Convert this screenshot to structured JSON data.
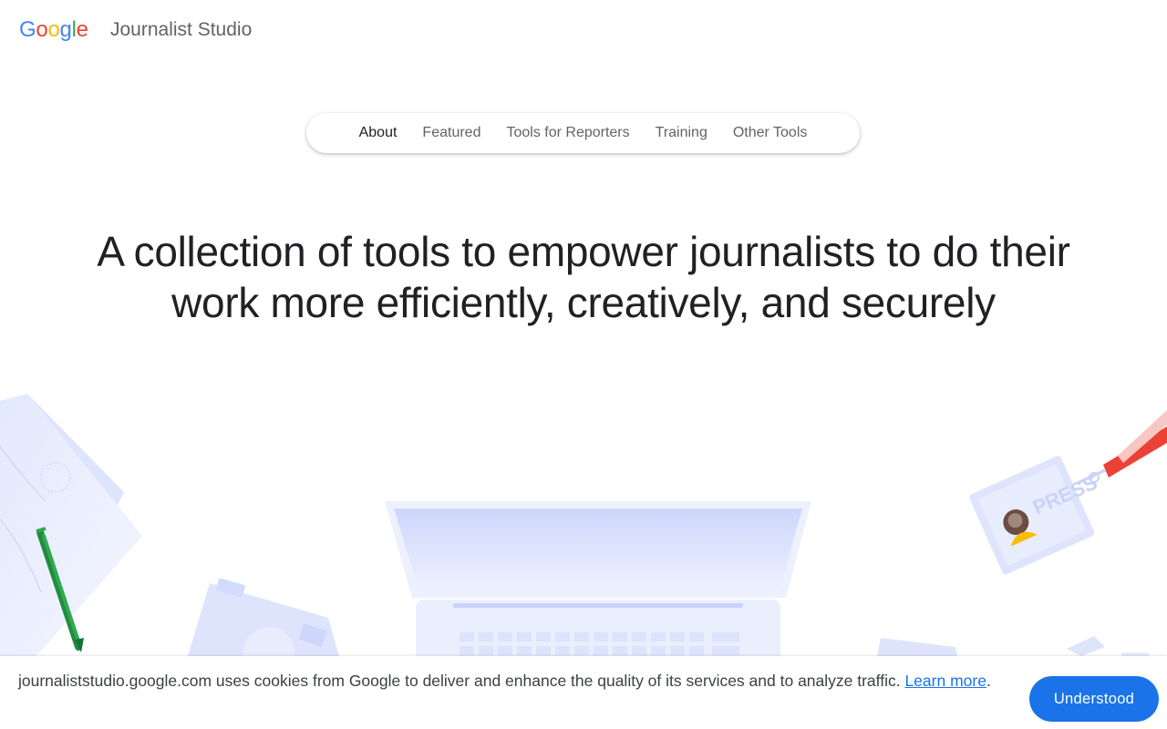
{
  "header": {
    "logo_letters": [
      "G",
      "o",
      "o",
      "g",
      "l",
      "e"
    ],
    "logo_colors": [
      "#4285F4",
      "#EA4335",
      "#FBBC05",
      "#4285F4",
      "#34A853",
      "#EA4335"
    ],
    "product_name": "Journalist Studio"
  },
  "nav": {
    "items": [
      {
        "label": "About",
        "active": true
      },
      {
        "label": "Featured",
        "active": false
      },
      {
        "label": "Tools for Reporters",
        "active": false
      },
      {
        "label": "Training",
        "active": false
      },
      {
        "label": "Other Tools",
        "active": false
      }
    ]
  },
  "hero": {
    "title": "A collection of tools to empower journalists to do their work more efficiently, creatively, and securely"
  },
  "illustration": {
    "press_badge_text": "PRESS",
    "icons": [
      "paper-sheets",
      "pen",
      "camera",
      "laptop",
      "press-badge",
      "lanyard"
    ]
  },
  "cookie_bar": {
    "message": "journaliststudio.google.com uses cookies from Google to deliver and enhance the quality of its services and to analyze traffic. ",
    "learn_more_label": "Learn more",
    "trailing": ".",
    "button_label": "Understood"
  },
  "colors": {
    "accent": "#1a73e8",
    "illustration_blue": "#dfe6fd"
  }
}
